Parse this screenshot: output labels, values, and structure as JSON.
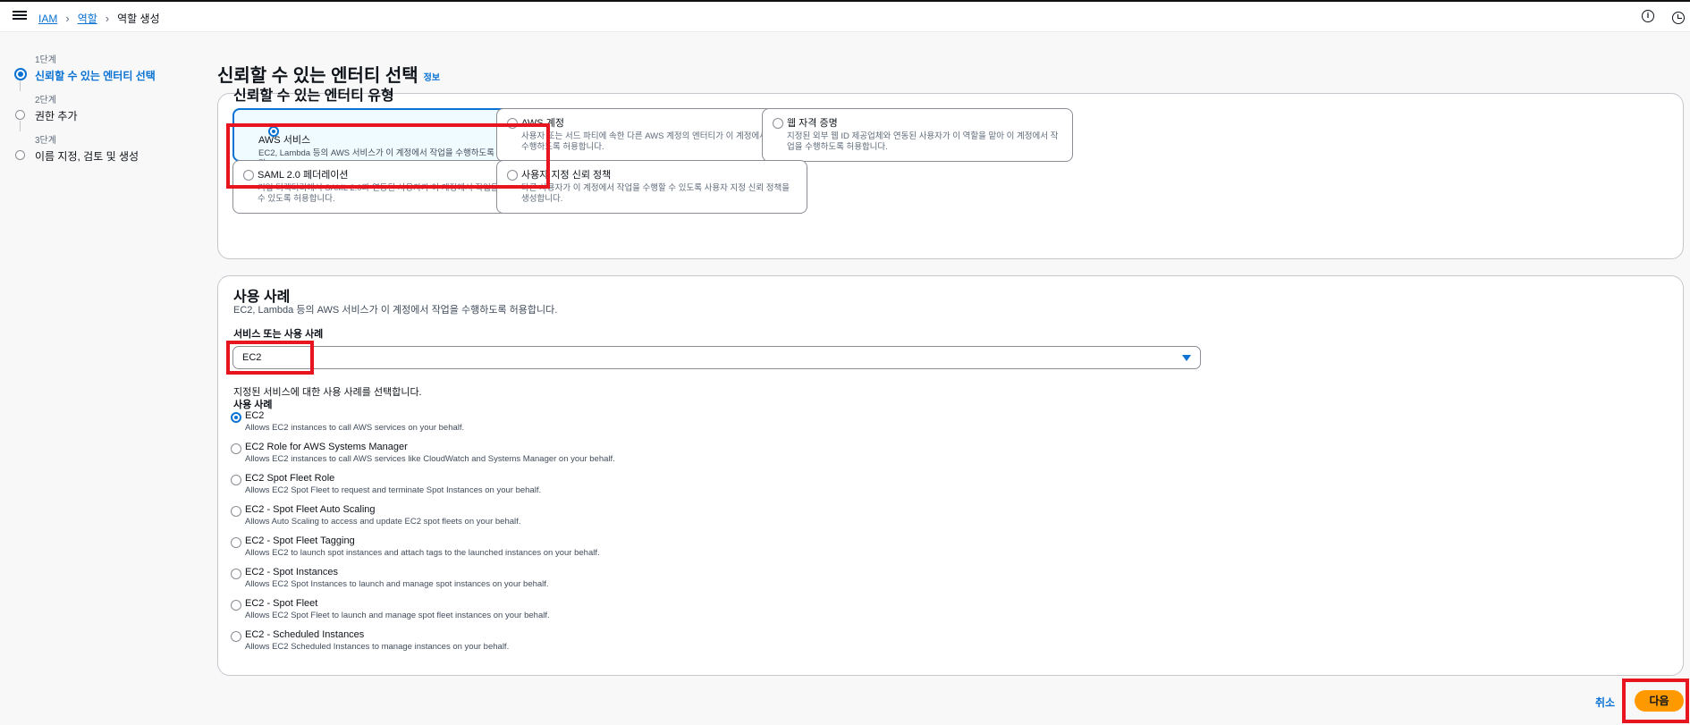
{
  "breadcrumb": {
    "items": [
      "IAM",
      "역할"
    ],
    "current": "역할 생성"
  },
  "steps": [
    {
      "num": "1단계",
      "title": "신뢰할 수 있는 엔터티 선택"
    },
    {
      "num": "2단계",
      "title": "권한 추가"
    },
    {
      "num": "3단계",
      "title": "이름 지정, 검토 및 생성"
    }
  ],
  "page": {
    "title": "신뢰할 수 있는 엔터티 선택",
    "info_link": "정보"
  },
  "entity_type": {
    "title": "신뢰할 수 있는 엔터티 유형",
    "options": [
      {
        "label": "AWS 서비스",
        "desc": "EC2, Lambda 등의 AWS 서비스가 이 계정에서 작업을 수행하도록 허용합니다.",
        "selected": true
      },
      {
        "label": "AWS 계정",
        "desc": "사용자 또는 서드 파티에 속한 다른 AWS 계정의 엔터티가 이 계정에서 작업을 수행하도록 허용합니다.",
        "selected": false
      },
      {
        "label": "웹 자격 증명",
        "desc": "지정된 외부 웹 ID 제공업체와 연동된 사용자가 이 역할을 맡아 이 계정에서 작업을 수행하도록 허용합니다.",
        "selected": false
      },
      {
        "label": "SAML 2.0 페더레이션",
        "desc": "기업 디렉터리에서 SAML 2.0과 연동된 사용자가 이 계정에서 작업을 수행할 수 있도록 허용합니다.",
        "selected": false
      },
      {
        "label": "사용자 지정 신뢰 정책",
        "desc": "다른 사용자가 이 계정에서 작업을 수행할 수 있도록 사용자 지정 신뢰 정책을 생성합니다.",
        "selected": false
      }
    ]
  },
  "use_case": {
    "title": "사용 사례",
    "subtitle": "EC2, Lambda 등의 AWS 서비스가 이 계정에서 작업을 수행하도록 허용합니다.",
    "service_label": "서비스 또는 사용 사례",
    "service_value": "EC2",
    "hint": "지정된 서비스에 대한 사용 사례를 선택합니다.",
    "list_label": "사용 사례",
    "options": [
      {
        "label": "EC2",
        "desc": "Allows EC2 instances to call AWS services on your behalf.",
        "selected": true
      },
      {
        "label": "EC2 Role for AWS Systems Manager",
        "desc": "Allows EC2 instances to call AWS services like CloudWatch and Systems Manager on your behalf.",
        "selected": false
      },
      {
        "label": "EC2 Spot Fleet Role",
        "desc": "Allows EC2 Spot Fleet to request and terminate Spot Instances on your behalf.",
        "selected": false
      },
      {
        "label": "EC2 - Spot Fleet Auto Scaling",
        "desc": "Allows Auto Scaling to access and update EC2 spot fleets on your behalf.",
        "selected": false
      },
      {
        "label": "EC2 - Spot Fleet Tagging",
        "desc": "Allows EC2 to launch spot instances and attach tags to the launched instances on your behalf.",
        "selected": false
      },
      {
        "label": "EC2 - Spot Instances",
        "desc": "Allows EC2 Spot Instances to launch and manage spot instances on your behalf.",
        "selected": false
      },
      {
        "label": "EC2 - Spot Fleet",
        "desc": "Allows EC2 Spot Fleet to launch and manage spot fleet instances on your behalf.",
        "selected": false
      },
      {
        "label": "EC2 - Scheduled Instances",
        "desc": "Allows EC2 Scheduled Instances to manage instances on your behalf.",
        "selected": false
      }
    ]
  },
  "actions": {
    "cancel": "취소",
    "next": "다음"
  },
  "colors": {
    "accent": "#0972d3",
    "primary_button": "#ff9900",
    "highlight": "#e8141f"
  }
}
